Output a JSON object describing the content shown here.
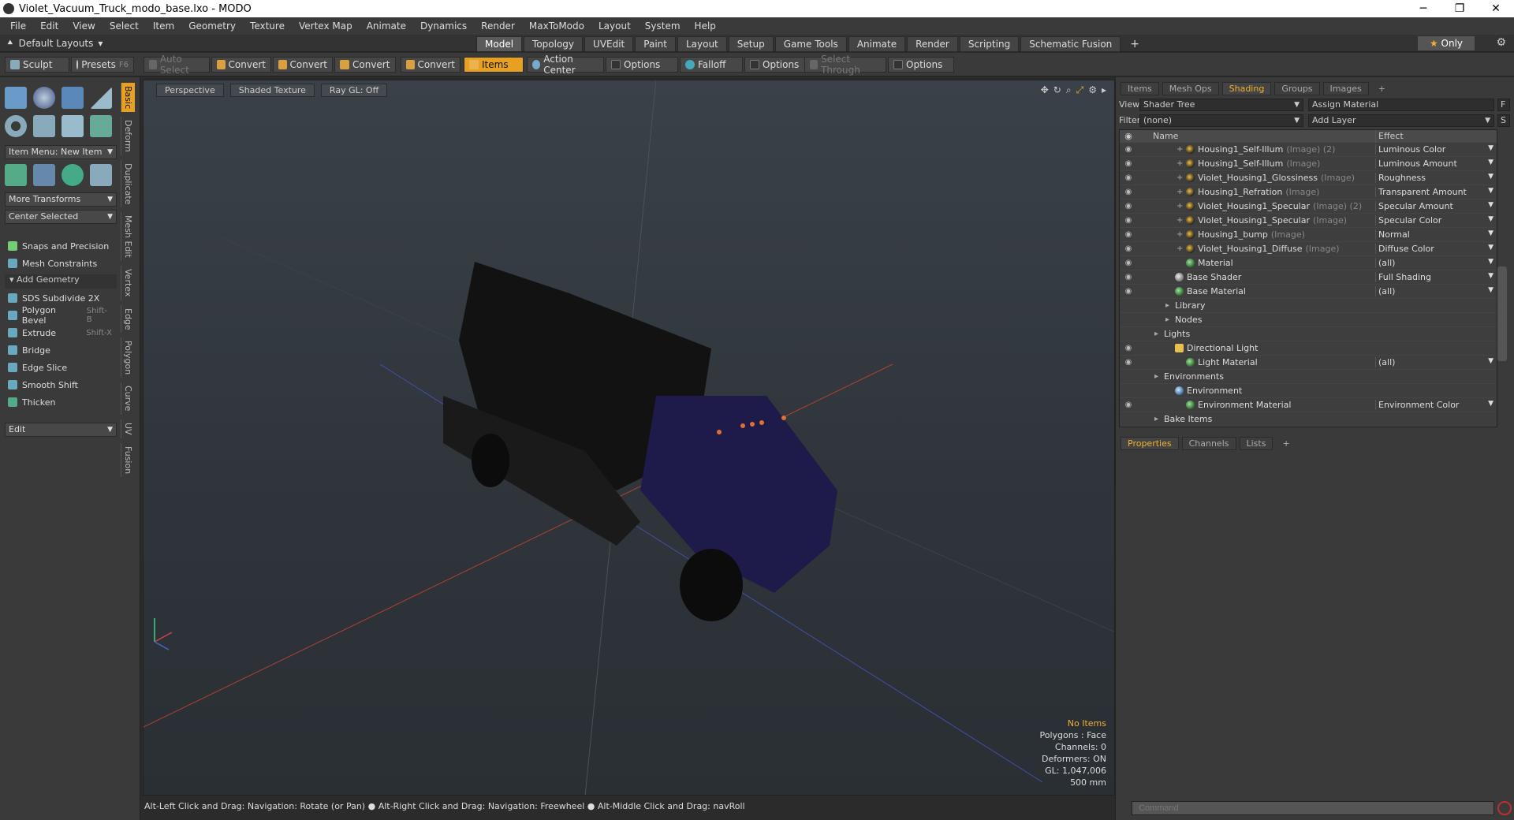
{
  "window": {
    "title": "Violet_Vacuum_Truck_modo_base.lxo - MODO"
  },
  "menu": [
    "File",
    "Edit",
    "View",
    "Select",
    "Item",
    "Geometry",
    "Texture",
    "Vertex Map",
    "Animate",
    "Dynamics",
    "Render",
    "MaxToModo",
    "Layout",
    "System",
    "Help"
  ],
  "layout": {
    "selector": "Default Layouts",
    "tabs": [
      "Model",
      "Topology",
      "UVEdit",
      "Paint",
      "Layout",
      "Setup",
      "Game Tools",
      "Animate",
      "Render",
      "Scripting",
      "Schematic Fusion"
    ],
    "active_tab": "Model",
    "add": "+",
    "only_label": "Only"
  },
  "toolbar": {
    "sculpt": "Sculpt",
    "presets": "Presets",
    "presets_key": "F6",
    "auto_select": "Auto Select",
    "convert1": "Convert",
    "convert2": "Convert",
    "convert3": "Convert",
    "convert4": "Convert",
    "items": "Items",
    "action_center": "Action Center",
    "options1": "Options",
    "falloff": "Falloff",
    "options2": "Options",
    "select_through": "Select Through",
    "options3": "Options"
  },
  "left": {
    "vtabs": [
      "Basic",
      "Deform",
      "Duplicate",
      "Mesh Edit",
      "Vertex",
      "Edge",
      "Polygon",
      "Curve",
      "UV",
      "Fusion"
    ],
    "item_menu": "Item Menu: New Item",
    "more_transforms": "More Transforms",
    "center_selected": "Center Selected",
    "snaps": "Snaps and Precision",
    "mesh_constraints": "Mesh Constraints",
    "add_geometry": "Add Geometry",
    "tools": [
      {
        "label": "SDS Subdivide 2X",
        "key": ""
      },
      {
        "label": "Polygon Bevel",
        "key": "Shift-B"
      },
      {
        "label": "Extrude",
        "key": "Shift-X"
      },
      {
        "label": "Bridge",
        "key": ""
      },
      {
        "label": "Edge Slice",
        "key": ""
      },
      {
        "label": "Smooth Shift",
        "key": ""
      },
      {
        "label": "Thicken",
        "key": ""
      }
    ],
    "edit": "Edit"
  },
  "viewport": {
    "view": "Perspective",
    "shading": "Shaded Texture",
    "raygl": "Ray GL: Off",
    "stats": {
      "items": "No Items",
      "polygons": "Polygons : Face",
      "channels": "Channels: 0",
      "deformers": "Deformers: ON",
      "gl": "GL: 1,047,006",
      "size": "500 mm"
    },
    "colors": {
      "truck_cab": "#1e1a4a",
      "tank": "#151515",
      "axis_x": "#c04030",
      "axis_z": "#4050b0"
    }
  },
  "status": "Alt-Left Click and Drag: Navigation: Rotate (or Pan) ● Alt-Right Click and Drag: Navigation: Freewheel ● Alt-Middle Click and Drag: navRoll",
  "right": {
    "tabs": [
      "Items",
      "Mesh Ops",
      "Shading",
      "Groups",
      "Images"
    ],
    "active_tab": "Shading",
    "view_label": "View",
    "view_value": "Shader Tree",
    "assign": "Assign Material",
    "f": "F",
    "filter_label": "Filter",
    "filter_value": "(none)",
    "add_layer": "Add Layer",
    "s": "S",
    "col_name": "Name",
    "col_effect": "Effect",
    "rows": [
      {
        "name": "Housing1_Self-Illum",
        "tag": "(Image) (2)",
        "effect": "Luminous Color",
        "eye": true,
        "indent": 3,
        "kind": "tex",
        "plus": true
      },
      {
        "name": "Housing1_Self-Illum",
        "tag": "(Image)",
        "effect": "Luminous Amount",
        "eye": true,
        "indent": 3,
        "kind": "tex",
        "plus": true
      },
      {
        "name": "Violet_Housing1_Glossiness",
        "tag": "(Image)",
        "effect": "Roughness",
        "eye": true,
        "indent": 3,
        "kind": "tex",
        "plus": true
      },
      {
        "name": "Housing1_Refration",
        "tag": "(Image)",
        "effect": "Transparent Amount",
        "eye": true,
        "indent": 3,
        "kind": "tex",
        "plus": true
      },
      {
        "name": "Violet_Housing1_Specular",
        "tag": "(Image) (2)",
        "effect": "Specular Amount",
        "eye": true,
        "indent": 3,
        "kind": "tex",
        "plus": true
      },
      {
        "name": "Violet_Housing1_Specular",
        "tag": "(Image)",
        "effect": "Specular Color",
        "eye": true,
        "indent": 3,
        "kind": "tex",
        "plus": true
      },
      {
        "name": "Housing1_bump",
        "tag": "(Image)",
        "effect": "Normal",
        "eye": true,
        "indent": 3,
        "kind": "tex",
        "plus": true
      },
      {
        "name": "Violet_Housing1_Diffuse",
        "tag": "(Image)",
        "effect": "Diffuse Color",
        "eye": true,
        "indent": 3,
        "kind": "tex",
        "plus": true
      },
      {
        "name": "Material",
        "tag": "",
        "effect": "(all)",
        "eye": true,
        "indent": 3,
        "kind": "mat",
        "plus": false
      },
      {
        "name": "Base Shader",
        "tag": "",
        "effect": "Full Shading",
        "eye": true,
        "indent": 2,
        "kind": "shd",
        "plus": false
      },
      {
        "name": "Base Material",
        "tag": "",
        "effect": "(all)",
        "eye": true,
        "indent": 2,
        "kind": "mat",
        "plus": false
      },
      {
        "name": "Library",
        "tag": "",
        "effect": "",
        "eye": false,
        "indent": 2,
        "kind": "",
        "plus": false
      },
      {
        "name": "Nodes",
        "tag": "",
        "effect": "",
        "eye": false,
        "indent": 2,
        "kind": "",
        "plus": false
      },
      {
        "name": "Lights",
        "tag": "",
        "effect": "",
        "eye": false,
        "indent": 1,
        "kind": "",
        "plus": false
      },
      {
        "name": "Directional Light",
        "tag": "",
        "effect": "",
        "eye": true,
        "indent": 2,
        "kind": "lit",
        "plus": false
      },
      {
        "name": "Light Material",
        "tag": "",
        "effect": "(all)",
        "eye": true,
        "indent": 3,
        "kind": "mat",
        "plus": false
      },
      {
        "name": "Environments",
        "tag": "",
        "effect": "",
        "eye": false,
        "indent": 1,
        "kind": "",
        "plus": false
      },
      {
        "name": "Environment",
        "tag": "",
        "effect": "",
        "eye": false,
        "indent": 2,
        "kind": "env",
        "plus": false
      },
      {
        "name": "Environment Material",
        "tag": "",
        "effect": "Environment Color",
        "eye": true,
        "indent": 3,
        "kind": "mat",
        "plus": false
      },
      {
        "name": "Bake Items",
        "tag": "",
        "effect": "",
        "eye": false,
        "indent": 1,
        "kind": "",
        "plus": false
      }
    ],
    "props_tabs": [
      "Properties",
      "Channels",
      "Lists"
    ],
    "props_active": "Properties",
    "command_placeholder": "Command"
  }
}
